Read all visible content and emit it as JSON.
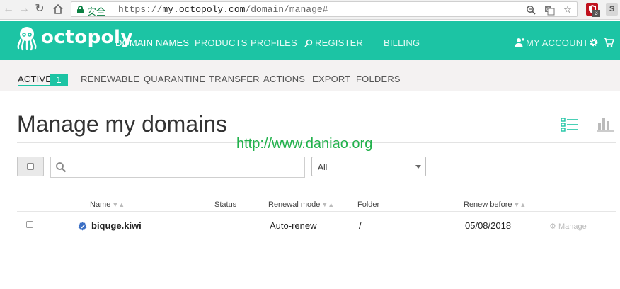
{
  "browser": {
    "secure_label": "安全",
    "url_scheme": "https://",
    "url_host": "my.octopoly.com",
    "url_path": "/domain/manage#_",
    "ext_badge_count": "3",
    "ext_s_label": "S"
  },
  "header": {
    "logo_text": "octopoly",
    "nav": [
      "DOMAIN NAMES",
      "PRODUCTS",
      "PROFILES",
      "REGISTER",
      "BILLING"
    ],
    "my_account": "MY ACCOUNT"
  },
  "sub_nav": {
    "items": [
      "ACTIVE",
      "RENEWABLE",
      "QUARANTINE",
      "TRANSFER",
      "ACTIONS",
      "EXPORT",
      "FOLDERS"
    ],
    "active_count": "1"
  },
  "main": {
    "title": "Manage my domains",
    "watermark": "http://www.daniao.org",
    "search_placeholder": "",
    "filter_value": "All"
  },
  "table": {
    "headers": [
      "Name",
      "Status",
      "Renewal mode",
      "Folder",
      "Renew before"
    ],
    "rows": [
      {
        "name": "biquge.kiwi",
        "status": "",
        "renewal_mode": "Auto-renew",
        "folder": "/",
        "renew_before": "05/08/2018",
        "action": "Manage"
      }
    ]
  },
  "colors": {
    "brand": "#1cc4a4",
    "watermark": "#22b14c",
    "verified": "#3b6fc4"
  }
}
